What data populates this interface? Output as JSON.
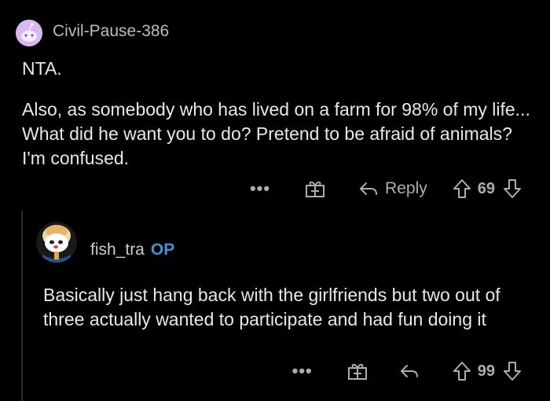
{
  "comment1": {
    "username": "Civil-Pause-386",
    "paragraph1": "NTA.",
    "paragraph2": "Also, as somebody who has lived on a farm for 98% of my life... What did he want you to do? Pretend to be afraid of animals? I'm confused.",
    "more_label": "•••",
    "reply_label": "Reply",
    "votes": "69",
    "icons": [
      "reddit-snoo-avatar",
      "gift-icon",
      "reply-arrow-icon",
      "upvote-icon",
      "downvote-icon"
    ],
    "avatar_color": "#d9b8f0"
  },
  "comment2": {
    "username": "fish_tra",
    "op_badge": "OP",
    "text": "Basically just hang back with the girlfriends but two out of three actually wanted to participate and had fun doing it",
    "more_label": "•••",
    "votes": "99",
    "icons": [
      "custom-snoo-avatar",
      "gift-icon",
      "reply-arrow-icon",
      "upvote-icon",
      "downvote-icon"
    ],
    "op_color": "#4a8dd9"
  }
}
